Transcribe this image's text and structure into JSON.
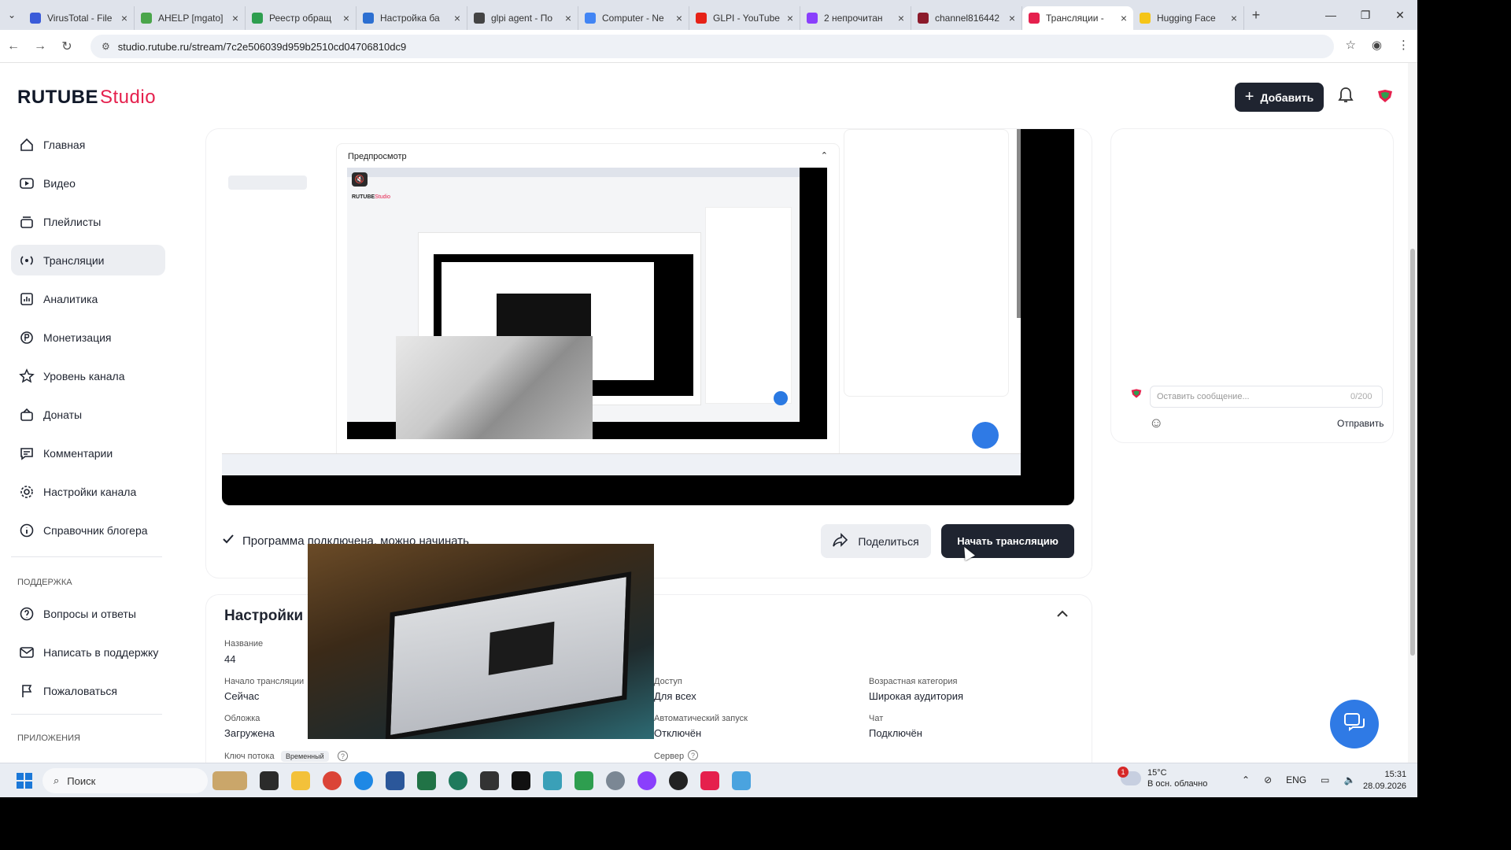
{
  "browser": {
    "tabs": [
      {
        "label": "VirusTotal - File",
        "color": "#3a5bd9",
        "active": false
      },
      {
        "label": "AHELP [mgato]",
        "color": "#4aa54a",
        "active": false
      },
      {
        "label": "Реестр обращ",
        "color": "#2e9e4f",
        "active": false
      },
      {
        "label": "Настройка ба",
        "color": "#2c6fd1",
        "active": false
      },
      {
        "label": "glpi agent - По",
        "color": "#444444",
        "active": false
      },
      {
        "label": "Computer - Ne",
        "color": "#4285f4",
        "active": false
      },
      {
        "label": "GLPI - YouTube",
        "color": "#e62117",
        "active": false
      },
      {
        "label": "2 непрочитан",
        "color": "#8a3ffc",
        "active": false
      },
      {
        "label": "channel816442",
        "color": "#8b1a2b",
        "active": false
      },
      {
        "label": "Трансляции -",
        "color": "#e5204d",
        "active": true
      },
      {
        "label": "Hugging Face",
        "color": "#f5c518",
        "active": false
      }
    ],
    "url": "studio.rutube.ru/stream/7c2e506039d959b2510cd04706810dc9"
  },
  "header": {
    "logo_main": "RUTUBE",
    "logo_studio": "Studio",
    "add_button": "Добавить"
  },
  "sidebar": {
    "items": [
      {
        "label": "Главная",
        "icon": "home-icon",
        "active": false
      },
      {
        "label": "Видео",
        "icon": "video-icon",
        "active": false
      },
      {
        "label": "Плейлисты",
        "icon": "playlist-icon",
        "active": false
      },
      {
        "label": "Трансляции",
        "icon": "broadcast-icon",
        "active": true
      },
      {
        "label": "Аналитика",
        "icon": "analytics-icon",
        "active": false
      },
      {
        "label": "Монетизация",
        "icon": "monetization-icon",
        "active": false
      },
      {
        "label": "Уровень канала",
        "icon": "star-icon",
        "active": false
      },
      {
        "label": "Донаты",
        "icon": "donate-icon",
        "active": false
      },
      {
        "label": "Комментарии",
        "icon": "comment-icon",
        "active": false
      },
      {
        "label": "Настройки канала",
        "icon": "gear-icon",
        "active": false
      },
      {
        "label": "Справочник блогера",
        "icon": "info-icon",
        "active": false
      }
    ],
    "support_title": "ПОДДЕРЖКА",
    "support_items": [
      {
        "label": "Вопросы и ответы",
        "icon": "question-icon"
      },
      {
        "label": "Написать в поддержку",
        "icon": "mail-icon"
      },
      {
        "label": "Пожаловаться",
        "icon": "flag-icon"
      }
    ],
    "apps_title": "ПРИЛОЖЕНИЯ"
  },
  "preview": {
    "title": "Предпросмотр",
    "status": "Программа подключена, можно начинать",
    "share_button": "Поделиться",
    "start_button": "Начать трансляцию"
  },
  "chat": {
    "placeholder": "Оставить сообщение...",
    "counter": "0/200",
    "send": "Отправить"
  },
  "settings": {
    "title": "Настройки",
    "name_label": "Название",
    "name_value": "44",
    "start_label": "Начало трансляции",
    "start_value": "Сейчас",
    "cover_label": "Обложка",
    "cover_value": "Загружена",
    "key_label": "Ключ потока",
    "key_badge": "Временный",
    "access_label": "Доступ",
    "access_value": "Для всех",
    "autostart_label": "Автоматический запуск",
    "autostart_value": "Отключён",
    "server_label": "Сервер",
    "age_label": "Возрастная категория",
    "age_value": "Широкая аудитория",
    "chat_label": "Чат",
    "chat_value": "Подключён"
  },
  "taskbar": {
    "search": "Поиск",
    "weather_temp": "15°C",
    "weather_desc": "В осн. облачно",
    "weather_badge": "1",
    "lang": "ENG",
    "time": "15:31",
    "date": "28.09.2026"
  }
}
